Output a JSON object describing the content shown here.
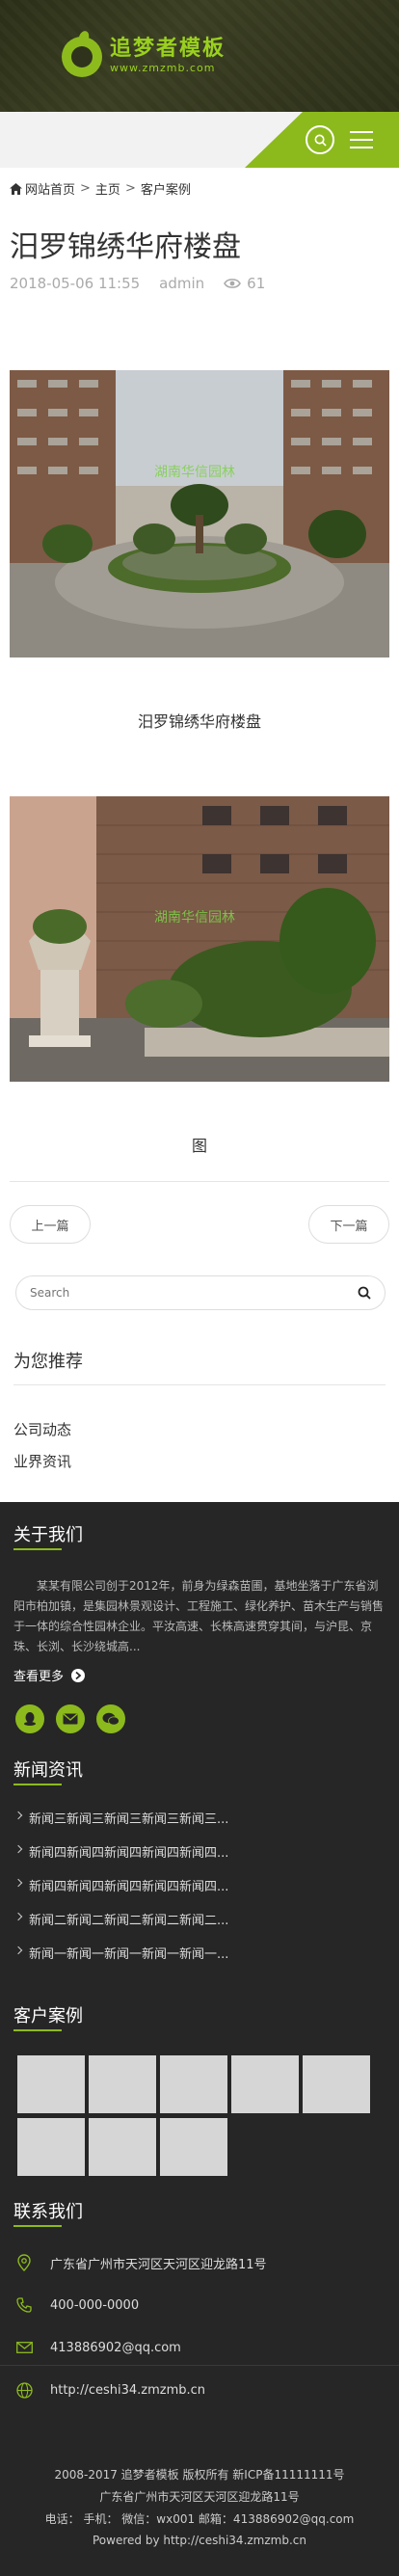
{
  "header": {
    "logo_title": "追梦者模板",
    "logo_url": "www.zmzmb.com"
  },
  "breadcrumb": {
    "home": "网站首页",
    "sep1": ">",
    "main": "主页",
    "sep2": ">",
    "category": "客户案例"
  },
  "article": {
    "title": "汨罗锦绣华府楼盘",
    "date": "2018-05-06 11:55",
    "author": "admin",
    "views": "61",
    "caption1": "汨罗锦绣华府楼盘",
    "caption2": "图",
    "watermark": "湖南华信园林"
  },
  "pager": {
    "prev": "上一篇",
    "next": "下一篇"
  },
  "search": {
    "placeholder": "Search"
  },
  "recommend": {
    "title": "为您推荐",
    "items": [
      "公司动态",
      "业界资讯"
    ]
  },
  "about": {
    "title": "关于我们",
    "text": "某某有限公司创于2012年，前身为绿森苗圃，基地坐落于广东省浏阳市柏加镇，是集园林景观设计、工程施工、绿化养护、苗木生产与销售于一体的综合性园林企业。平汝高速、长株高速贯穿其间，与沪昆、京珠、长浏、长沙绕城高...",
    "more": "查看更多"
  },
  "news": {
    "title": "新闻资讯",
    "items": [
      "新闻三新闻三新闻三新闻三新闻三...",
      "新闻四新闻四新闻四新闻四新闻四...",
      "新闻四新闻四新闻四新闻四新闻四...",
      "新闻二新闻二新闻二新闻二新闻二...",
      "新闻一新闻一新闻一新闻一新闻一..."
    ]
  },
  "cases": {
    "title": "客户案例"
  },
  "contact": {
    "title": "联系我们",
    "address": "广东省广州市天河区天河区迎龙路11号",
    "phone": "400-000-0000",
    "email": "413886902@qq.com",
    "website": "http://ceshi34.zmzmb.cn"
  },
  "footer": {
    "line1": "2008-2017 追梦者模板 版权所有 新ICP备11111111号",
    "line2": "广东省广州市天河区天河区迎龙路11号",
    "line3": "电话： 手机： 微信：wx001 邮箱：413886902@qq.com",
    "line4": "Powered by http://ceshi34.zmzmb.cn"
  },
  "colors": {
    "accent": "#8cba1d",
    "dark_bg": "#262626"
  }
}
